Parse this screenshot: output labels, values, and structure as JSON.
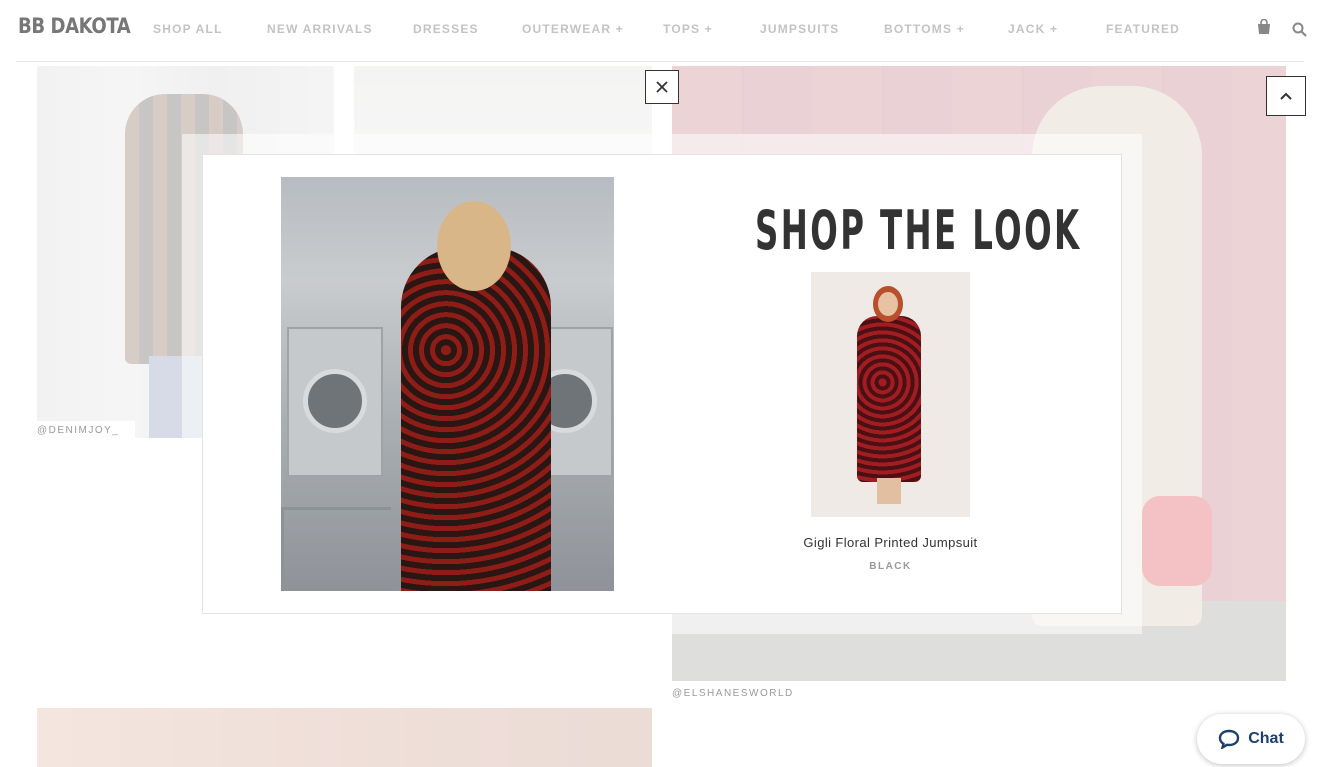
{
  "brand": {
    "logo_text": "BB DAKOTA"
  },
  "nav": {
    "items": [
      {
        "label": "SHOP ALL"
      },
      {
        "label": "NEW ARRIVALS"
      },
      {
        "label": "DRESSES"
      },
      {
        "label": "OUTERWEAR +"
      },
      {
        "label": "TOPS +"
      },
      {
        "label": "JUMPSUITS"
      },
      {
        "label": "BOTTOMS +"
      },
      {
        "label": "JACK +"
      },
      {
        "label": "FEATURED"
      }
    ],
    "icons": {
      "cart": "shopping-bag-icon",
      "search": "search-icon"
    }
  },
  "gallery": {
    "captions": [
      "@DENIMJOY_",
      "@ELSHANESWORLD"
    ]
  },
  "modal": {
    "title": "SHOP THE LOOK",
    "close_icon": "close-icon",
    "product": {
      "name": "Gigli Floral Printed Jumpsuit",
      "color": "BLACK"
    }
  },
  "floating": {
    "back_to_top_icon": "chevron-up-icon",
    "chat_label": "Chat",
    "chat_icon": "chat-bubble-icon",
    "chat_color": "#1c3f6e"
  }
}
